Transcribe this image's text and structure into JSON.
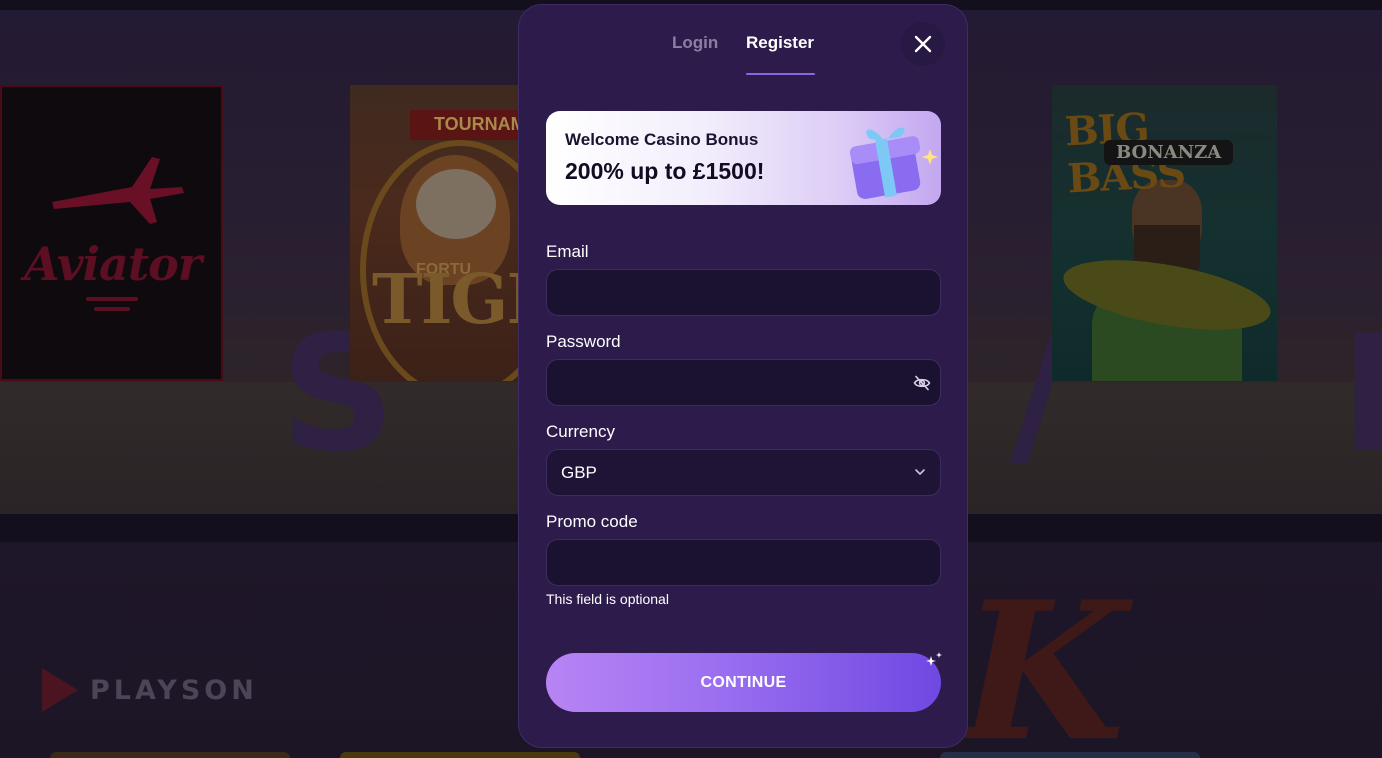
{
  "background": {
    "games": [
      {
        "name": "Aviator"
      },
      {
        "name": "Fortune Tiger",
        "banner": "TOURNAM",
        "word_small": "FORTU",
        "word_big": "TIGE"
      },
      {
        "name": "Big Bass Bonanza",
        "title": "BIG BASS",
        "subtitle": "BONANZA"
      }
    ],
    "provider_logo": "PLAYSON"
  },
  "modal": {
    "tabs": [
      {
        "label": "Login",
        "active": false
      },
      {
        "label": "Register",
        "active": true
      }
    ],
    "close_icon": "close-icon",
    "bonus": {
      "title": "Welcome Casino Bonus",
      "amount": "200% up to £1500!",
      "icon": "gift-icon"
    },
    "form": {
      "email": {
        "label": "Email",
        "value": "",
        "placeholder": ""
      },
      "password": {
        "label": "Password",
        "value": "",
        "placeholder": "",
        "toggle_icon": "eye-off-icon"
      },
      "currency": {
        "label": "Currency",
        "selected": "GBP",
        "icon": "chevron-down-icon"
      },
      "promo": {
        "label": "Promo code",
        "value": "",
        "placeholder": "",
        "hint": "This field is optional"
      }
    },
    "submit_label": "CONTINUE"
  },
  "colors": {
    "modal_bg": "#2c1b4b",
    "input_bg": "#1b1131",
    "accent": "#8a67e0",
    "button_start": "#b884f4",
    "button_end": "#6f48e2"
  }
}
